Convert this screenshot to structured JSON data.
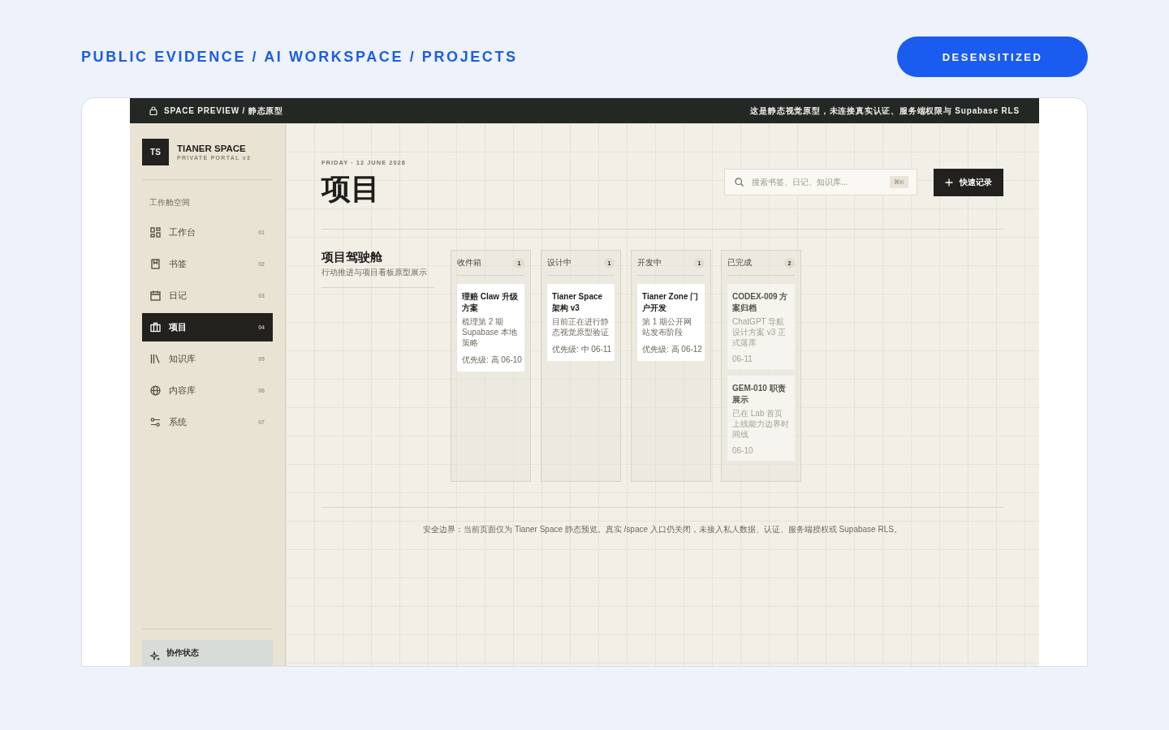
{
  "page_header": {
    "breadcrumb": "PUBLIC EVIDENCE / AI WORKSPACE / PROJECTS",
    "badge": "DESENSITIZED"
  },
  "top_bar": {
    "title": "SPACE PREVIEW / 静态原型",
    "notice": "这是静态视觉原型，未连接真实认证、服务端权限与 Supabase RLS"
  },
  "sidebar": {
    "logo": "TS",
    "brand": "TIANER SPACE",
    "subtitle": "PRIVATE PORTAL v3",
    "section": "工作舱空间",
    "items": [
      {
        "label": "工作台",
        "number": "01",
        "selected": false
      },
      {
        "label": "书签",
        "number": "02",
        "selected": false
      },
      {
        "label": "日记",
        "number": "03",
        "selected": false
      },
      {
        "label": "项目",
        "number": "04",
        "selected": true
      },
      {
        "label": "知识库",
        "number": "05",
        "selected": false
      },
      {
        "label": "内容库",
        "number": "06",
        "selected": false
      },
      {
        "label": "系统",
        "number": "07",
        "selected": false
      }
    ],
    "status_card": {
      "title": "协作状态"
    }
  },
  "main": {
    "date": "FRIDAY · 12 JUNE 2026",
    "title": "项目",
    "search": {
      "placeholder": "搜索书签、日记、知识库...",
      "shortcut": "⌘K"
    },
    "quick_button": "快速记录",
    "board": {
      "title": "项目驾驶舱",
      "subtitle": "行动推进与项目看板原型展示",
      "columns": [
        {
          "name": "收件箱",
          "count": "1",
          "cards": [
            {
              "title": "理赔 Claw 升级方案",
              "description": "梳理第 2 期 Supabase 本地策略",
              "meta": "优先级: 高 06-10",
              "muted": false
            }
          ]
        },
        {
          "name": "设计中",
          "count": "1",
          "cards": [
            {
              "title": "Tianer Space 架构 v3",
              "description": "目前正在进行静态视觉原型验证",
              "meta": "优先级: 中 06-11",
              "muted": false
            }
          ]
        },
        {
          "name": "开发中",
          "count": "1",
          "cards": [
            {
              "title": "Tianer Zone 门户开发",
              "description": "第 1 期公开网站发布阶段",
              "meta": "优先级: 高 06-12",
              "muted": false
            }
          ]
        },
        {
          "name": "已完成",
          "count": "2",
          "cards": [
            {
              "title": "CODEX-009 方案归档",
              "description": "ChatGPT 导航设计方案 v3 正式落库",
              "meta": "06-11",
              "muted": true
            },
            {
              "title": "GEM-010 职责展示",
              "description": "已在 Lab 首页上线能力边界时间线",
              "meta": "06-10",
              "muted": true
            }
          ]
        }
      ]
    },
    "footer_note": "安全边界：当前页面仅为 Tianer Space 静态预览。真实 /space 入口仍关闭，未接入私人数据、认证、服务端授权或 Supabase RLS。"
  }
}
